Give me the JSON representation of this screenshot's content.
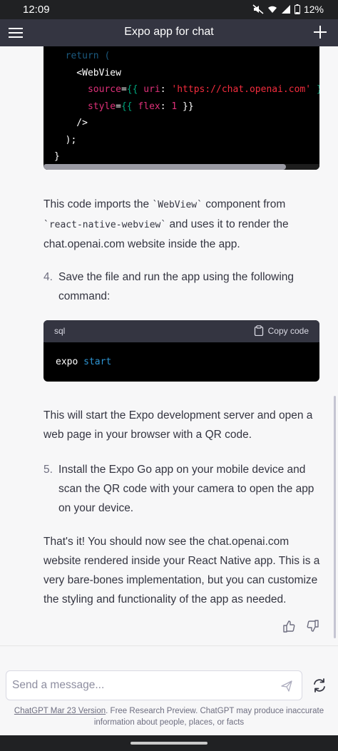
{
  "status_bar": {
    "time": "12:09",
    "battery": "12%",
    "icons": [
      "mute-icon",
      "wifi-icon",
      "signal-icon",
      "battery-icon"
    ]
  },
  "header": {
    "title": "Expo app for chat",
    "menu_icon": "hamburger-menu-icon",
    "new_chat_icon": "plus-icon"
  },
  "code_block_1": {
    "lines": [
      "  return (",
      "    <WebView",
      "      source={{ uri: 'https://chat.openai.com' }}",
      "      style={{ flex: 1 }}",
      "    />",
      "  );",
      "}"
    ]
  },
  "paragraph_1": {
    "before": "This code imports the ",
    "code1": "`WebView`",
    "middle": " component from ",
    "code2": "`react-native-webview`",
    "after": " and uses it to render the chat.openai.com website inside the app."
  },
  "list_item_4": {
    "number": "4.",
    "text": "Save the file and run the app using the following command:"
  },
  "code_block_2": {
    "language": "sql",
    "copy_label": "Copy code",
    "copy_icon": "clipboard-icon",
    "command": "expo",
    "argument": "start"
  },
  "paragraph_2": "This will start the Expo development server and open a web page in your browser with a QR code.",
  "list_item_5": {
    "number": "5.",
    "text": "Install the Expo Go app on your mobile device and scan the QR code with your camera to open the app on your device."
  },
  "paragraph_3": "That's it! You should now see the chat.openai.com website rendered inside your React Native app. This is a very bare-bones implementation, but you can customize the styling and functionality of the app as needed.",
  "feedback": {
    "like_icon": "thumbs-up-icon",
    "dislike_icon": "thumbs-down-icon"
  },
  "composer": {
    "placeholder": "Send a message...",
    "value": "",
    "send_icon": "send-icon",
    "regenerate_icon": "refresh-icon"
  },
  "disclaimer": {
    "link_text": "ChatGPT Mar 23 Version",
    "text": ". Free Research Preview. ChatGPT may produce inaccurate information about people, places, or facts"
  }
}
